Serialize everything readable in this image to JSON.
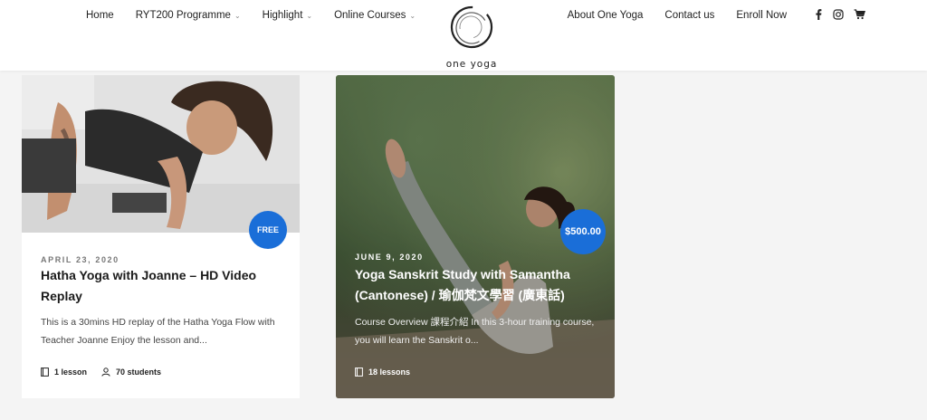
{
  "nav": {
    "left": [
      {
        "label": "Home",
        "dropdown": false
      },
      {
        "label": "RYT200 Programme",
        "dropdown": true
      },
      {
        "label": "Highlight",
        "dropdown": true
      },
      {
        "label": "Online Courses",
        "dropdown": true
      }
    ],
    "right": [
      {
        "label": "About One Yoga"
      },
      {
        "label": "Contact us"
      },
      {
        "label": "Enroll Now"
      }
    ],
    "social_icons": [
      "facebook-icon",
      "instagram-icon",
      "cart-icon"
    ]
  },
  "logo": {
    "text": "one yoga"
  },
  "courses": [
    {
      "badge": "FREE",
      "date": "APRIL 23, 2020",
      "title": "Hatha Yoga with Joanne – HD Video Replay",
      "excerpt": "This is a 30mins HD replay of the Hatha Yoga Flow with Teacher Joanne Enjoy the lesson and...",
      "lessons": "1 lesson",
      "students": "70 students"
    },
    {
      "badge": "$500.00",
      "date": "JUNE 9, 2020",
      "title": "Yoga Sanskrit Study with Samantha (Cantonese) / 瑜伽梵文學習 (廣東話)",
      "excerpt": "Course Overview 課程介紹 In this 3-hour training course, you will learn the Sanskrit o...",
      "lessons": "18 lessons"
    }
  ],
  "colors": {
    "badge": "#1a6ed8",
    "header_bg": "#ffffff",
    "page_bg": "#f4f4f4"
  }
}
